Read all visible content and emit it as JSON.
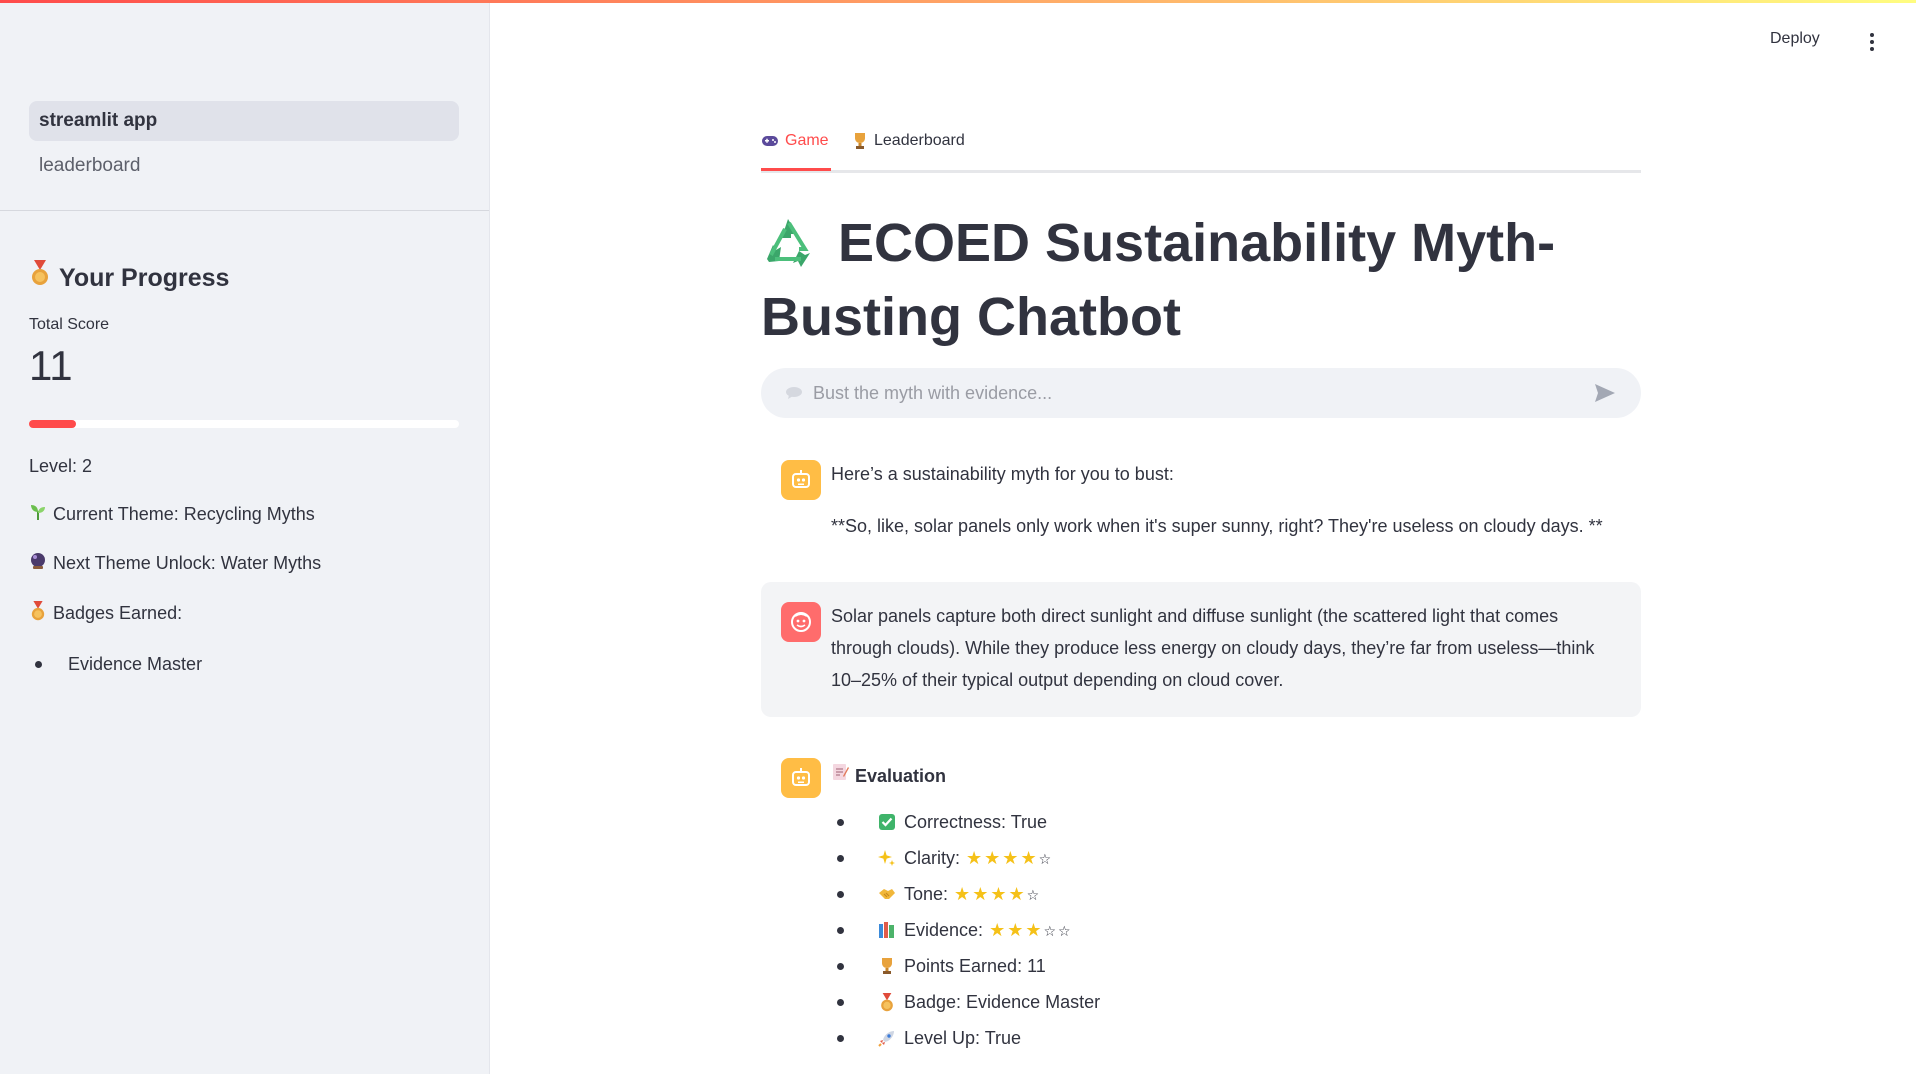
{
  "sidebar": {
    "nav": [
      {
        "label": "streamlit app",
        "active": true
      },
      {
        "label": "leaderboard",
        "active": false
      }
    ],
    "progress_heading": "Your Progress",
    "total_score_label": "Total Score",
    "total_score": "11",
    "progress_fraction": 0.11,
    "level": "Level: 2",
    "current_theme": "Current Theme: Recycling Myths",
    "next_theme": "Next Theme Unlock: Water Myths",
    "badges_label": "Badges Earned:",
    "badges": [
      "Evidence Master"
    ]
  },
  "header": {
    "deploy_label": "Deploy"
  },
  "tabs": [
    {
      "label": "Game",
      "active": true
    },
    {
      "label": "Leaderboard",
      "active": false
    }
  ],
  "main": {
    "title": "ECOED Sustainability Myth-Busting Chatbot",
    "chat_placeholder": "Bust the myth with evidence...",
    "messages": [
      {
        "role": "assistant",
        "intro": "Here’s a sustainability myth for you to bust:",
        "myth": "**So, like, solar panels only work when it's super sunny, right? They're useless on cloudy days. **"
      },
      {
        "role": "user",
        "text": "Solar panels capture both direct sunlight and diffuse sunlight (the scattered light that comes through clouds). While they produce less energy on cloudy days, they’re far from useless—think 10–25% of their typical output depending on cloud cover."
      }
    ],
    "evaluation": {
      "heading": "Evaluation",
      "items": [
        {
          "icon": "check-icon",
          "text": "Correctness: True"
        },
        {
          "icon": "sparkles-icon",
          "text": "Clarity:",
          "stars": 4,
          "max": 5
        },
        {
          "icon": "handshake-icon",
          "text": "Tone:",
          "stars": 4,
          "max": 5
        },
        {
          "icon": "books-icon",
          "text": "Evidence:",
          "stars": 3,
          "max": 5
        },
        {
          "icon": "trophy-icon",
          "text": "Points Earned: 11"
        },
        {
          "icon": "medal-icon",
          "text": "Badge: Evidence Master"
        },
        {
          "icon": "rocket-icon",
          "text": "Level Up: True"
        }
      ]
    }
  },
  "colors": {
    "accent": "#ff4b4b",
    "sidebar_bg": "#f0f2f6",
    "bot_avatar": "#ffbd45",
    "user_avatar": "#ff6c6c",
    "star": "#f5c118"
  }
}
